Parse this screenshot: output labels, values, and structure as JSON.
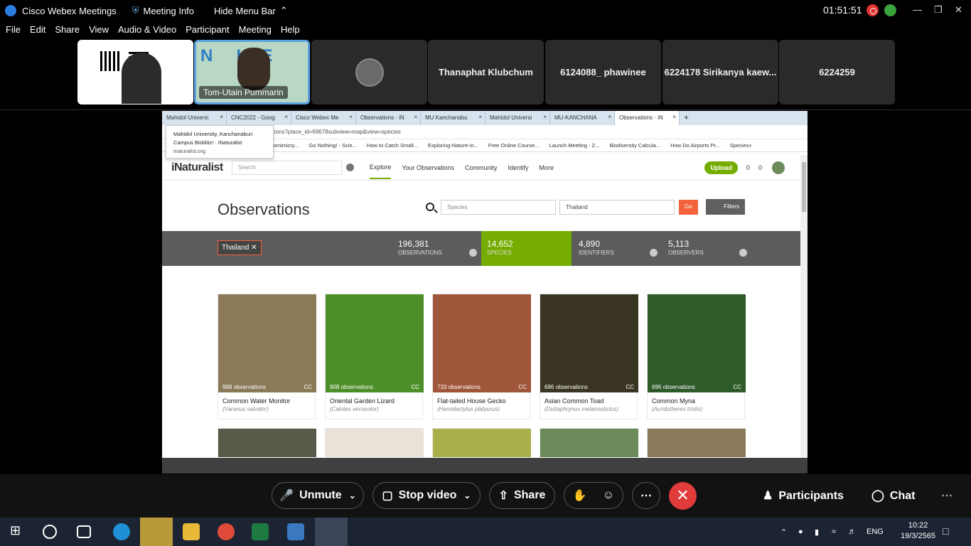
{
  "webex": {
    "app_title": "Cisco Webex Meetings",
    "meeting_info": "Meeting Info",
    "hide_menu": "Hide Menu Bar",
    "clock": "01:51:51",
    "menu": [
      "File",
      "Edit",
      "Share",
      "View",
      "Audio & Video",
      "Participant",
      "Meeting",
      "Help"
    ],
    "participants": [
      {
        "name": "Tom-Utain Pummarin"
      },
      {
        "name": "Thanaphat Klubchum"
      },
      {
        "name": "6124088_ phawinee"
      },
      {
        "name": "6224178 Sirikanya kaew..."
      },
      {
        "name": "6224259"
      }
    ],
    "controls": {
      "unmute": "Unmute",
      "stop_video": "Stop video",
      "share": "Share",
      "participants": "Participants",
      "chat": "Chat"
    }
  },
  "browser": {
    "tabs": [
      "Mahidol Universi",
      "CNC2022 - Goog",
      "Cisco Webex Me",
      "Observations · iN",
      "MU Kanchanabu",
      "Mahidol Universi",
      "MU-KANCHANA",
      "Observations · iN"
    ],
    "url": "ervations?place_id=69678subview=map&view=species",
    "bookmarks": [
      "Biomimicry...",
      "Go Nothing! - Scie...",
      "How to Catch Small...",
      "Exploring-Nature-in...",
      "Free Online Course...",
      "Launch Meeting - Z...",
      "Biodiversity Calcula...",
      "How Do Airports Pr...",
      "Species+"
    ],
    "tooltip": {
      "title": "Mahidol University, Kanchanaburi Campus Bioblitz! · iNaturalist",
      "domain": "inaturalist.org"
    }
  },
  "inat": {
    "logo": "iNaturalist",
    "search_placeholder": "Search",
    "nav": [
      "Explore",
      "Your Observations",
      "Community",
      "Identify",
      "More"
    ],
    "upload": "Upload",
    "messages": "0",
    "notifications": "0",
    "page_title": "Observations",
    "species_placeholder": "Species",
    "place_value": "Thailand",
    "go": "Go",
    "filters": "Filters",
    "place_chip": "Thailand",
    "stats": [
      {
        "num": "196,381",
        "label": "OBSERVATIONS"
      },
      {
        "num": "14,652",
        "label": "SPECIES"
      },
      {
        "num": "4,890",
        "label": "IDENTIFIERS"
      },
      {
        "num": "5,113",
        "label": "OBSERVERS"
      }
    ],
    "species": [
      {
        "count": "998 observations",
        "license": "CC",
        "common": "Common Water Monitor",
        "sci": "(Varanus salvator)",
        "color": "#8a7a58"
      },
      {
        "count": "908 observations",
        "license": "CC",
        "common": "Oriental Garden Lizard",
        "sci": "(Calotes versicolor)",
        "color": "#4f8f2a"
      },
      {
        "count": "733 observations",
        "license": "CC",
        "common": "Flat-tailed House Gecko",
        "sci": "(Hemidactylus platyurus)",
        "color": "#a0563a"
      },
      {
        "count": "696 observations",
        "license": "CC",
        "common": "Asian Common Toad",
        "sci": "(Duttaphrynus melanostictus)",
        "color": "#3a3522"
      },
      {
        "count": "696 observations",
        "license": "CC",
        "common": "Common Myna",
        "sci": "(Acridotheres tristis)",
        "color": "#2f5a2a"
      }
    ]
  },
  "taskbar": {
    "lang": "ENG",
    "time": "10:22",
    "date": "19/3/2565"
  }
}
